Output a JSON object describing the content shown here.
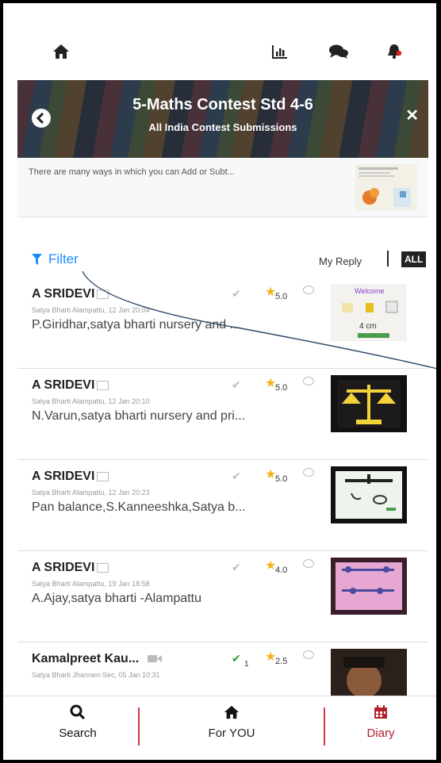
{
  "topbar": {
    "home_icon": "home-icon",
    "chart_icon": "bar-chart-icon",
    "chat_icon": "chat-icon",
    "bell_icon": "bell-icon"
  },
  "banner": {
    "title": "5-Maths Contest Std 4-6",
    "subtitle": "All India Contest Submissions"
  },
  "description": {
    "text": "There are many ways in which you can Add or Subt..."
  },
  "filter": {
    "label": "Filter",
    "my_reply": "My Reply",
    "all": "ALL"
  },
  "items": [
    {
      "name": "A SRIDEVI",
      "meta": "Satya Bharti Alampattu, 12 Jan 20:04",
      "text": "P.Giridhar,satya bharti nursery and ...",
      "rating": "5.0",
      "check_count": ""
    },
    {
      "name": "A SRIDEVI",
      "meta": "Satya Bharti Alampattu, 12 Jan 20:10",
      "text": "N.Varun,satya bharti nursery and pri...",
      "rating": "5.0",
      "check_count": ""
    },
    {
      "name": "A SRIDEVI",
      "meta": "Satya Bharti Alampattu, 12 Jan 20:23",
      "text": "Pan balance,S.Kanneeshka,Satya b...",
      "rating": "5.0",
      "check_count": ""
    },
    {
      "name": "A SRIDEVI",
      "meta": "Satya Bharti Alampattu, 19 Jan 18:58",
      "text": "A.Ajay,satya bharti -Alampattu",
      "rating": "4.0",
      "check_count": ""
    },
    {
      "name": "Kamalpreet Kau...",
      "meta": "Satya Bharti Jhanneri-Sec, 05 Jan 10:31",
      "text": "",
      "rating": "2.5",
      "check_count": "1"
    }
  ],
  "bottom_nav": {
    "search": "Search",
    "for_you": "For YOU",
    "diary": "Diary"
  },
  "colors": {
    "accent": "#1a8cff",
    "star": "#f3b21d",
    "diary": "#b3212d",
    "check_green": "#2aa12a"
  }
}
